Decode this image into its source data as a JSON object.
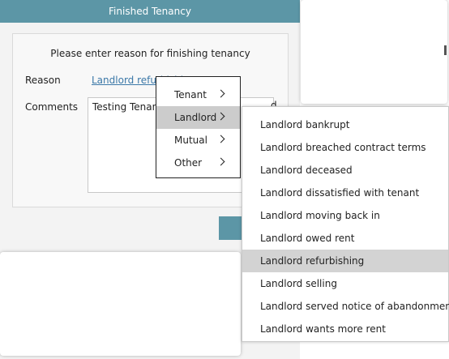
{
  "dialog": {
    "title": "Finished Tenancy",
    "prompt": "Please enter reason for finishing tenancy",
    "reason_label": "Reason",
    "reason_value": "Landlord refurbishing",
    "comments_label": "Comments",
    "comments_value": "Testing Tenancy",
    "comments_tail": "d"
  },
  "reason_menu": {
    "items": [
      {
        "label": "Tenant"
      },
      {
        "label": "Landlord"
      },
      {
        "label": "Mutual"
      },
      {
        "label": "Other"
      }
    ],
    "active": "Landlord"
  },
  "landlord_submenu": {
    "items": [
      {
        "label": "Landlord bankrupt"
      },
      {
        "label": "Landlord breached contract terms"
      },
      {
        "label": "Landlord deceased"
      },
      {
        "label": "Landlord dissatisfied with tenant"
      },
      {
        "label": "Landlord moving back in"
      },
      {
        "label": "Landlord owed rent"
      },
      {
        "label": "Landlord refurbishing"
      },
      {
        "label": "Landlord selling"
      },
      {
        "label": "Landlord served notice of abandonment"
      },
      {
        "label": "Landlord wants more rent"
      }
    ],
    "active": "Landlord refurbishing"
  },
  "colors": {
    "accent": "#5c96a6",
    "link": "#3b78a8",
    "highlight": "#d3d3d3"
  }
}
